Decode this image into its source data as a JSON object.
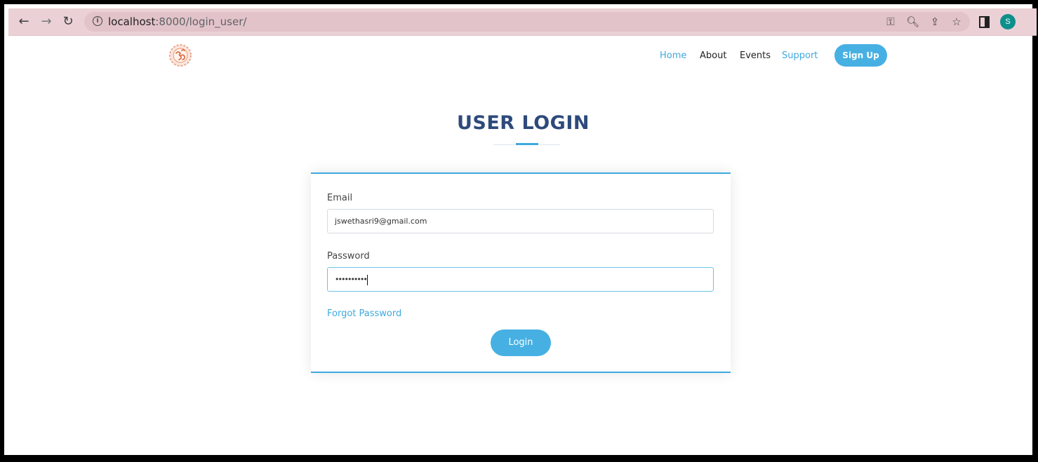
{
  "browser": {
    "url_host": "localhost",
    "url_rest": ":8000/login_user/",
    "profile_initial": "S"
  },
  "nav": {
    "items": [
      "Home",
      "About",
      "Events",
      "Support"
    ],
    "signup_label": "Sign Up"
  },
  "page": {
    "title": "USER LOGIN"
  },
  "form": {
    "email_label": "Email",
    "email_value": "jswethasri9@gmail.com",
    "password_label": "Password",
    "password_value": "••••••••••",
    "forgot_label": "Forgot Password",
    "login_label": "Login"
  },
  "colors": {
    "accent": "#3ea9de",
    "title": "#2e4a7a",
    "toolbar": "#ebd1d6"
  }
}
